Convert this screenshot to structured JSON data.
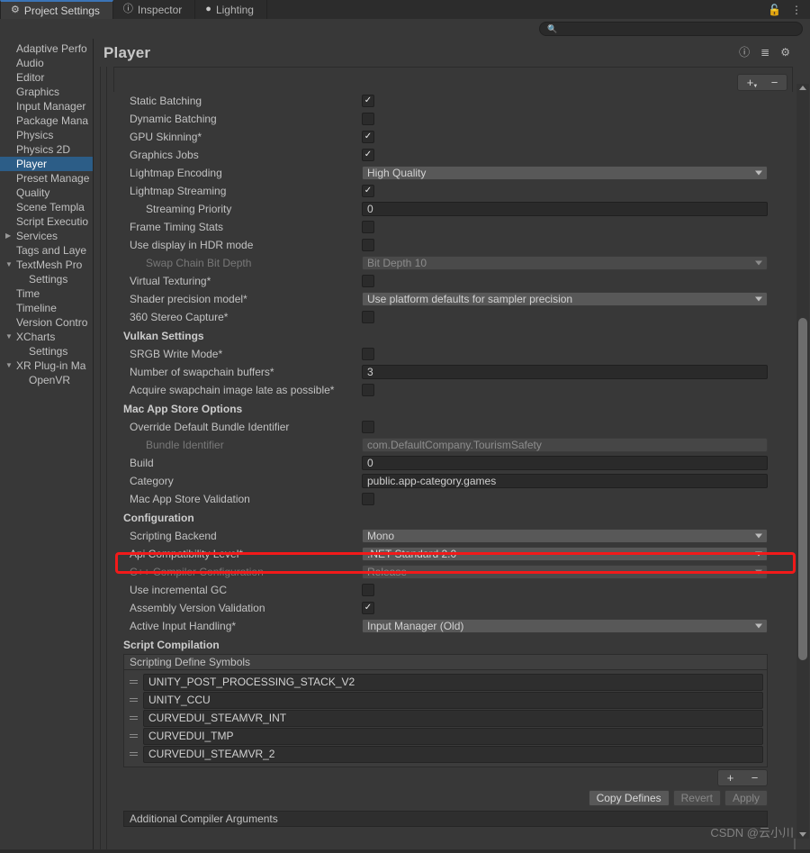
{
  "window": {
    "tabs": [
      {
        "label": "Project Settings",
        "icon": "gear-icon",
        "active": true
      },
      {
        "label": "Inspector",
        "icon": "info-icon",
        "active": false
      },
      {
        "label": "Lighting",
        "icon": "bulb-icon",
        "active": false
      }
    ],
    "lock_icon": "lock-open-icon",
    "menu_icon": "kebab-menu-icon"
  },
  "search": {
    "value": "",
    "placeholder": "",
    "icon": "search-icon"
  },
  "sidebar": {
    "items": [
      {
        "label": "Adaptive Perfo",
        "indent": false,
        "arrow": "",
        "selected": false
      },
      {
        "label": "Audio",
        "indent": false,
        "arrow": "",
        "selected": false
      },
      {
        "label": "Editor",
        "indent": false,
        "arrow": "",
        "selected": false
      },
      {
        "label": "Graphics",
        "indent": false,
        "arrow": "",
        "selected": false
      },
      {
        "label": "Input Manager",
        "indent": false,
        "arrow": "",
        "selected": false
      },
      {
        "label": "Package Mana",
        "indent": false,
        "arrow": "",
        "selected": false
      },
      {
        "label": "Physics",
        "indent": false,
        "arrow": "",
        "selected": false
      },
      {
        "label": "Physics 2D",
        "indent": false,
        "arrow": "",
        "selected": false
      },
      {
        "label": "Player",
        "indent": false,
        "arrow": "",
        "selected": true
      },
      {
        "label": "Preset Manage",
        "indent": false,
        "arrow": "",
        "selected": false
      },
      {
        "label": "Quality",
        "indent": false,
        "arrow": "",
        "selected": false
      },
      {
        "label": "Scene Templa",
        "indent": false,
        "arrow": "",
        "selected": false
      },
      {
        "label": "Script Executio",
        "indent": false,
        "arrow": "",
        "selected": false
      },
      {
        "label": "Services",
        "indent": false,
        "arrow": "▶",
        "selected": false
      },
      {
        "label": "Tags and Laye",
        "indent": false,
        "arrow": "",
        "selected": false
      },
      {
        "label": "TextMesh Pro",
        "indent": false,
        "arrow": "▼",
        "selected": false
      },
      {
        "label": "Settings",
        "indent": true,
        "arrow": "",
        "selected": false
      },
      {
        "label": "Time",
        "indent": false,
        "arrow": "",
        "selected": false
      },
      {
        "label": "Timeline",
        "indent": false,
        "arrow": "",
        "selected": false
      },
      {
        "label": "Version Contro",
        "indent": false,
        "arrow": "",
        "selected": false
      },
      {
        "label": "XCharts",
        "indent": false,
        "arrow": "▼",
        "selected": false
      },
      {
        "label": "Settings",
        "indent": true,
        "arrow": "",
        "selected": false
      },
      {
        "label": "XR Plug-in Ma",
        "indent": false,
        "arrow": "▼",
        "selected": false
      },
      {
        "label": "OpenVR",
        "indent": true,
        "arrow": "",
        "selected": false
      }
    ]
  },
  "page": {
    "title": "Player",
    "header_icons": [
      {
        "name": "help-icon",
        "glyph": "?"
      },
      {
        "name": "preset-icon",
        "glyph": "☲"
      },
      {
        "name": "settings-gear-icon",
        "glyph": "⚙"
      }
    ]
  },
  "toolbar": {
    "add_label": "+",
    "remove_label": "−"
  },
  "rendering_rows": [
    {
      "label": "Static Batching",
      "type": "checkbox",
      "checked": true,
      "dim": false,
      "sub": false
    },
    {
      "label": "Dynamic Batching",
      "type": "checkbox",
      "checked": false,
      "dim": false,
      "sub": false
    },
    {
      "label": "GPU Skinning*",
      "type": "checkbox",
      "checked": true,
      "dim": false,
      "sub": false
    },
    {
      "label": "Graphics Jobs",
      "type": "checkbox",
      "checked": true,
      "dim": false,
      "sub": false
    },
    {
      "label": "Lightmap Encoding",
      "type": "dropdown",
      "value": "High Quality",
      "dim": false,
      "sub": false
    },
    {
      "label": "Lightmap Streaming",
      "type": "checkbox",
      "checked": true,
      "dim": false,
      "sub": false
    },
    {
      "label": "Streaming Priority",
      "type": "text",
      "value": "0",
      "dim": false,
      "sub": true
    },
    {
      "label": "Frame Timing Stats",
      "type": "checkbox",
      "checked": false,
      "dim": false,
      "sub": false
    },
    {
      "label": "Use display in HDR mode",
      "type": "checkbox",
      "checked": false,
      "dim": false,
      "sub": false
    },
    {
      "label": "Swap Chain Bit Depth",
      "type": "dropdown",
      "value": "Bit Depth 10",
      "dim": true,
      "sub": true,
      "disabled": true
    },
    {
      "label": "Virtual Texturing*",
      "type": "checkbox",
      "checked": false,
      "dim": false,
      "sub": false
    },
    {
      "label": "Shader precision model*",
      "type": "dropdown",
      "value": "Use platform defaults for sampler precision",
      "dim": false,
      "sub": false
    },
    {
      "label": "360 Stereo Capture*",
      "type": "checkbox",
      "checked": false,
      "dim": false,
      "sub": false
    }
  ],
  "vulkan": {
    "title": "Vulkan Settings",
    "rows": [
      {
        "label": "SRGB Write Mode*",
        "type": "checkbox",
        "checked": false,
        "dim": false,
        "sub": false
      },
      {
        "label": "Number of swapchain buffers*",
        "type": "text",
        "value": "3",
        "dim": false,
        "sub": false
      },
      {
        "label": "Acquire swapchain image late as possible*",
        "type": "checkbox",
        "checked": false,
        "dim": false,
        "sub": false
      }
    ]
  },
  "mac_app_store": {
    "title": "Mac App Store Options",
    "rows": [
      {
        "label": "Override Default Bundle Identifier",
        "type": "checkbox",
        "checked": false,
        "dim": false,
        "sub": false
      },
      {
        "label": "Bundle Identifier",
        "type": "text",
        "value": "com.DefaultCompany.TourismSafety",
        "dim": true,
        "sub": true,
        "disabled": true
      },
      {
        "label": "Build",
        "type": "text",
        "value": "0",
        "dim": false,
        "sub": false
      },
      {
        "label": "Category",
        "type": "text",
        "value": "public.app-category.games",
        "dim": false,
        "sub": false
      },
      {
        "label": "Mac App Store Validation",
        "type": "checkbox",
        "checked": false,
        "dim": false,
        "sub": false
      }
    ]
  },
  "configuration": {
    "title": "Configuration",
    "rows": [
      {
        "label": "Scripting Backend",
        "type": "dropdown",
        "value": "Mono",
        "dim": false,
        "sub": false
      },
      {
        "label": "Api Compatibility Level*",
        "type": "dropdown",
        "value": ".NET Standard 2.0",
        "dim": false,
        "sub": false,
        "highlighted": true
      },
      {
        "label": "C++ Compiler Configuration",
        "type": "dropdown",
        "value": "Release",
        "dim": true,
        "sub": false,
        "disabled": true
      },
      {
        "label": "Use incremental GC",
        "type": "checkbox",
        "checked": false,
        "dim": false,
        "sub": false
      },
      {
        "label": "Assembly Version Validation",
        "type": "checkbox",
        "checked": true,
        "dim": false,
        "sub": false
      },
      {
        "label": "Active Input Handling*",
        "type": "dropdown",
        "value": "Input Manager (Old)",
        "dim": false,
        "sub": false
      }
    ]
  },
  "script_compilation": {
    "title": "Script Compilation",
    "defines_header": "Scripting Define Symbols",
    "defines": [
      "UNITY_POST_PROCESSING_STACK_V2",
      "UNITY_CCU",
      "CURVEDUI_STEAMVR_INT",
      "CURVEDUI_TMP",
      "CURVEDUI_STEAMVR_2"
    ],
    "buttons": [
      {
        "label": "Copy Defines",
        "disabled": false
      },
      {
        "label": "Revert",
        "disabled": true
      },
      {
        "label": "Apply",
        "disabled": true
      }
    ],
    "additional_args_label": "Additional Compiler Arguments"
  },
  "watermark": "CSDN @云小川",
  "colors": {
    "accent_selection": "#2c5d87",
    "highlight_red": "#f21a1a",
    "panel_bg": "#383838",
    "dropdown_bg": "#585858",
    "field_bg": "#2a2a2a"
  }
}
